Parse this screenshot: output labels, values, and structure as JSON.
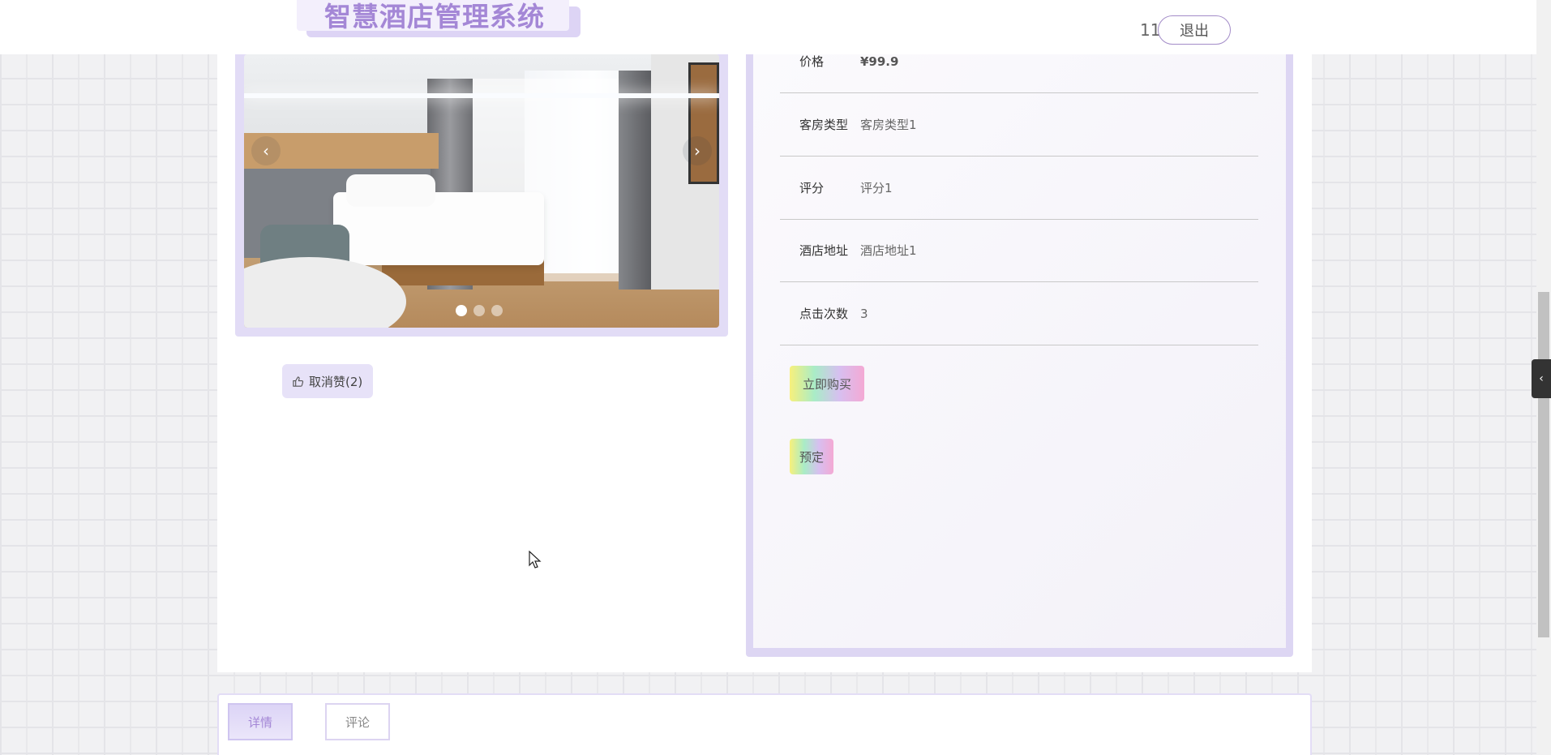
{
  "header": {
    "app_title": "智慧酒店管理系统",
    "username": "11",
    "logout_label": "退出"
  },
  "carousel": {
    "prev_icon": "‹",
    "next_icon": "›",
    "slide_count": 3,
    "active_slide": 1
  },
  "like": {
    "label": "取消赞(2)",
    "icon": "thumbs-up-icon"
  },
  "details": {
    "rows": [
      {
        "label": "价格",
        "value": "¥99.9"
      },
      {
        "label": "客房类型",
        "value": "客房类型1"
      },
      {
        "label": "评分",
        "value": "评分1"
      },
      {
        "label": "酒店地址",
        "value": "酒店地址1"
      },
      {
        "label": "点击次数",
        "value": "3"
      }
    ],
    "buy_label": "立即购买",
    "book_label": "预定"
  },
  "tabs": [
    {
      "label": "详情",
      "active": true
    },
    {
      "label": "评论",
      "active": false
    }
  ],
  "side_tab_icon": "‹",
  "colors": {
    "accent": "#a487d6",
    "panel_border": "#ddd6f3"
  }
}
